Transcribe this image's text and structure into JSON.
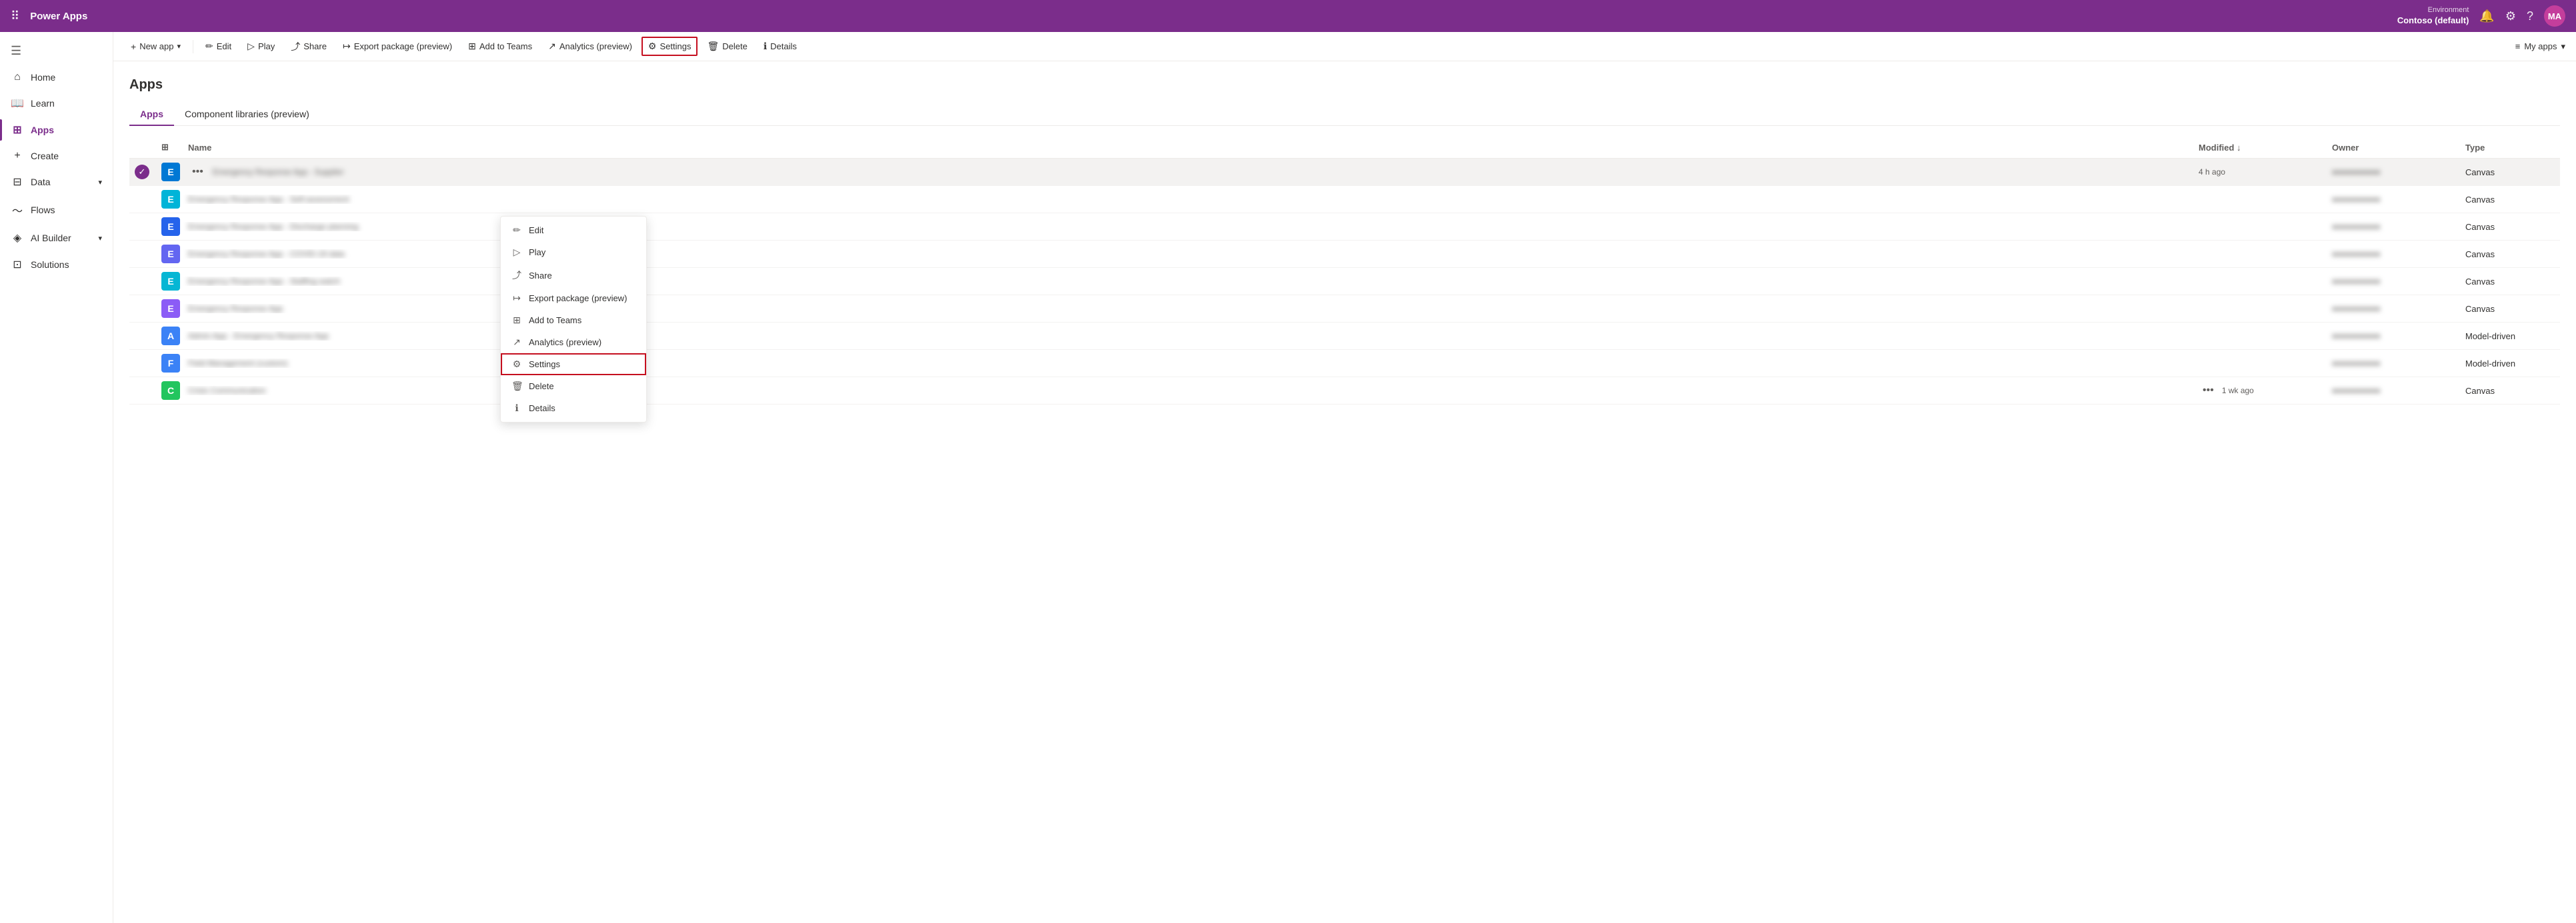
{
  "app_name": "Power Apps",
  "top_bar": {
    "env_label": "Environment",
    "env_name": "Contoso (default)",
    "avatar_initials": "MA"
  },
  "command_bar": {
    "new_app": "New app",
    "edit": "Edit",
    "play": "Play",
    "share": "Share",
    "export_package": "Export package (preview)",
    "add_to_teams": "Add to Teams",
    "analytics": "Analytics (preview)",
    "settings": "Settings",
    "delete": "Delete",
    "details": "Details",
    "my_apps": "My apps"
  },
  "sidebar": {
    "collapse_label": "Collapse",
    "items": [
      {
        "id": "home",
        "label": "Home",
        "icon": "⌂",
        "active": false
      },
      {
        "id": "learn",
        "label": "Learn",
        "icon": "📖",
        "active": false
      },
      {
        "id": "apps",
        "label": "Apps",
        "icon": "⊞",
        "active": true
      },
      {
        "id": "create",
        "label": "Create",
        "icon": "+",
        "active": false
      },
      {
        "id": "data",
        "label": "Data",
        "icon": "⊟",
        "active": false,
        "expandable": true
      },
      {
        "id": "flows",
        "label": "Flows",
        "icon": "~",
        "active": false
      },
      {
        "id": "ai_builder",
        "label": "AI Builder",
        "icon": "◈",
        "active": false,
        "expandable": true
      },
      {
        "id": "solutions",
        "label": "Solutions",
        "icon": "⊡",
        "active": false
      }
    ]
  },
  "page": {
    "title": "Apps",
    "tabs": [
      {
        "id": "apps",
        "label": "Apps",
        "active": true
      },
      {
        "id": "component_libraries",
        "label": "Component libraries (preview)",
        "active": false
      }
    ]
  },
  "table": {
    "columns": [
      {
        "id": "select",
        "label": ""
      },
      {
        "id": "icon",
        "label": ""
      },
      {
        "id": "name",
        "label": "Name"
      },
      {
        "id": "modified",
        "label": "Modified ↓"
      },
      {
        "id": "owner",
        "label": "Owner"
      },
      {
        "id": "type",
        "label": "Type"
      }
    ],
    "rows": [
      {
        "selected": true,
        "icon_color": "#0078d4",
        "icon_letter": "E",
        "name": "Emergency Response App - Supplier",
        "name_blurred": true,
        "modified": "4 h ago",
        "modified_dots": true,
        "owner": "redacted owner",
        "type": "Canvas"
      },
      {
        "selected": false,
        "icon_color": "#00b4d8",
        "icon_letter": "E",
        "name": "Emergency Response App - Self-assessment",
        "name_blurred": true,
        "modified": "",
        "modified_dots": false,
        "owner": "redacted owner",
        "type": "Canvas"
      },
      {
        "selected": false,
        "icon_color": "#2563eb",
        "icon_letter": "E",
        "name": "Emergency Response App - Discharge planning",
        "name_blurred": true,
        "modified": "",
        "modified_dots": false,
        "owner": "redacted owner",
        "type": "Canvas"
      },
      {
        "selected": false,
        "icon_color": "#6366f1",
        "icon_letter": "E",
        "name": "Emergency Response App - COVID-19 data",
        "name_blurred": true,
        "modified": "",
        "modified_dots": false,
        "owner": "redacted owner",
        "type": "Canvas"
      },
      {
        "selected": false,
        "icon_color": "#06b6d4",
        "icon_letter": "E",
        "name": "Emergency Response App - Staffing watch",
        "name_blurred": true,
        "modified": "",
        "modified_dots": false,
        "owner": "redacted owner",
        "type": "Canvas"
      },
      {
        "selected": false,
        "icon_color": "#8b5cf6",
        "icon_letter": "E",
        "name": "Emergency Response App",
        "name_blurred": true,
        "modified": "",
        "modified_dots": false,
        "owner": "redacted owner",
        "type": "Canvas"
      },
      {
        "selected": false,
        "icon_color": "#3b82f6",
        "icon_letter": "A",
        "name": "Admin App - Emergency Response App",
        "name_blurred": true,
        "modified": "",
        "modified_dots": false,
        "owner": "redacted owner",
        "type": "Model-driven"
      },
      {
        "selected": false,
        "icon_color": "#3b82f6",
        "icon_letter": "F",
        "name": "Field Management (custom)",
        "name_blurred": true,
        "modified": "",
        "modified_dots": false,
        "owner": "redacted owner",
        "type": "Model-driven"
      },
      {
        "selected": false,
        "icon_color": "#22c55e",
        "icon_letter": "C",
        "name": "Crisis Communication",
        "name_blurred": true,
        "modified": "1 wk ago",
        "modified_dots": true,
        "owner": "redacted owner",
        "type": "Canvas"
      }
    ]
  },
  "context_menu": {
    "items": [
      {
        "id": "edit",
        "icon": "✏",
        "label": "Edit"
      },
      {
        "id": "play",
        "icon": "▷",
        "label": "Play"
      },
      {
        "id": "share",
        "icon": "⤴",
        "label": "Share"
      },
      {
        "id": "export_package",
        "icon": "↦",
        "label": "Export package (preview)"
      },
      {
        "id": "add_to_teams",
        "icon": "⊞",
        "label": "Add to Teams"
      },
      {
        "id": "analytics",
        "icon": "↗",
        "label": "Analytics (preview)"
      },
      {
        "id": "settings",
        "icon": "⚙",
        "label": "Settings",
        "highlighted": true
      },
      {
        "id": "delete",
        "icon": "🗑",
        "label": "Delete"
      },
      {
        "id": "details",
        "icon": "ℹ",
        "label": "Details"
      }
    ]
  }
}
